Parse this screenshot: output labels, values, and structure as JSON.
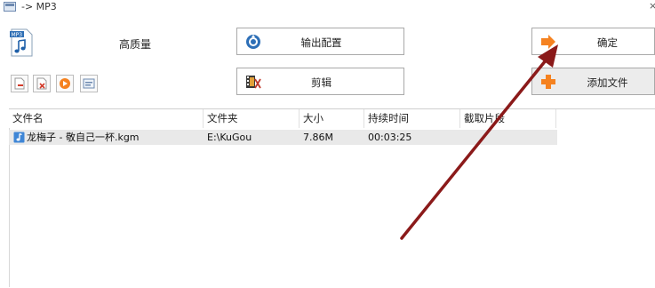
{
  "window": {
    "title": "-> MP3",
    "close_glyph": "×"
  },
  "format": {
    "icon": "mp3-file-icon",
    "badge": "MP3",
    "quality_label": "高质量"
  },
  "buttons": {
    "output_config": {
      "label": "输出配置",
      "icon": "output-config-icon"
    },
    "edit": {
      "label": "剪辑",
      "icon": "clip-edit-icon"
    },
    "ok": {
      "label": "确定",
      "icon": "arrow-right-icon"
    },
    "add_file": {
      "label": "添加文件",
      "icon": "plus-icon"
    }
  },
  "toolbar": {
    "items": [
      {
        "name": "remove-file-icon"
      },
      {
        "name": "clear-list-icon"
      },
      {
        "name": "play-icon"
      },
      {
        "name": "file-info-icon"
      }
    ]
  },
  "table": {
    "columns": [
      "文件名",
      "文件夹",
      "大小",
      "持续时间",
      "截取片段"
    ],
    "rows": [
      {
        "name": "龙梅子 - 敬自己一杯.kgm",
        "folder": "E:\\KuGou",
        "size": "7.86M",
        "duration": "00:03:25",
        "clip": ""
      }
    ]
  },
  "colors": {
    "annotation_arrow": "#8b1a1a",
    "selected_row": "#e9e9e9",
    "ok_arrow": "#f58220",
    "add_plus": "#f58220"
  }
}
